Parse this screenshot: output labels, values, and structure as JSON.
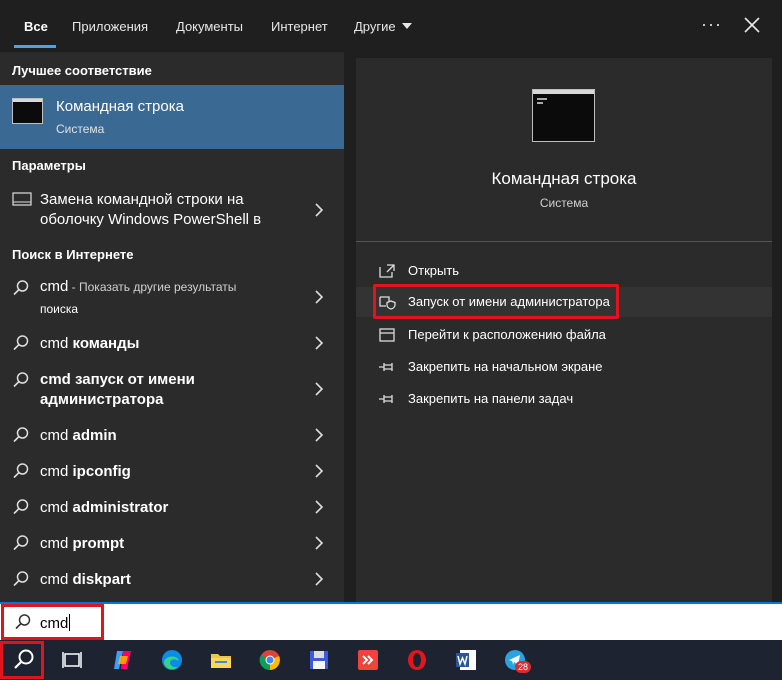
{
  "tabs": {
    "all": "Все",
    "apps": "Приложения",
    "docs": "Документы",
    "web": "Интернет",
    "more": "Другие"
  },
  "toolbar": {
    "more_dots": "···"
  },
  "sections": {
    "best_match": "Лучшее соответствие",
    "settings": "Параметры",
    "web_search": "Поиск в Интернете"
  },
  "best_match": {
    "title": "Командная строка",
    "subtitle": "Система"
  },
  "settings_item": {
    "line1": "Замена командной строки на",
    "line2": "оболочку Windows PowerShell в"
  },
  "web_results": [
    {
      "prefix": "cmd",
      "suffix": " - Показать другие результаты",
      "line2": "поиска"
    },
    {
      "prefix": "cmd ",
      "bold": "команды"
    },
    {
      "prefix": "cmd запуск от имени",
      "line2": "администратора"
    },
    {
      "prefix": "cmd ",
      "bold": "admin"
    },
    {
      "prefix": "cmd ",
      "bold": "ipconfig"
    },
    {
      "prefix": "cmd ",
      "bold": "administrator"
    },
    {
      "prefix": "cmd ",
      "bold": "prompt"
    },
    {
      "prefix": "cmd ",
      "bold": "diskpart"
    }
  ],
  "preview": {
    "title": "Командная строка",
    "subtitle": "Система",
    "actions": [
      {
        "label": "Открыть",
        "icon": "open-icon"
      },
      {
        "label": "Запуск от имени администратора",
        "icon": "shield-icon"
      },
      {
        "label": "Перейти к расположению файла",
        "icon": "folder-icon"
      },
      {
        "label": "Закрепить на начальном экране",
        "icon": "pin-icon"
      },
      {
        "label": "Закрепить на панели задач",
        "icon": "pin-icon"
      }
    ]
  },
  "search": {
    "value": "cmd"
  },
  "taskbar": {
    "telegram_badge": "28",
    "icons": [
      "search-icon",
      "task-view-icon",
      "copilot-icon",
      "edge-icon",
      "file-explorer-icon",
      "chrome-icon",
      "floppy-icon",
      "anydesk-icon",
      "opera-icon",
      "word-icon",
      "telegram-icon"
    ]
  },
  "colors": {
    "accent": "#4fa3e0",
    "selected": "#3a6a93",
    "highlight": "#e0141e"
  }
}
